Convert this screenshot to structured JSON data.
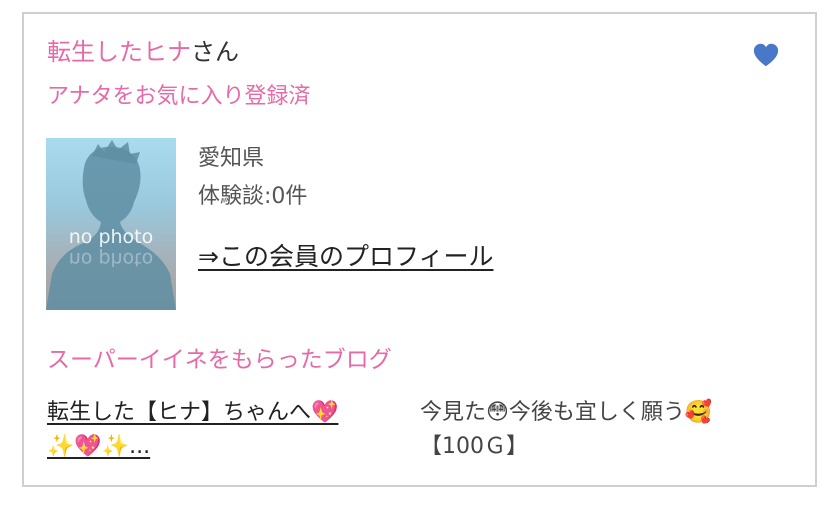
{
  "member": {
    "name": "転生したヒナ",
    "honorific": "さん",
    "favorite_status": "アナタをお気に入り登録済",
    "photo_placeholder": "no photo",
    "prefecture": "愛知県",
    "reviews": "体験談:0件",
    "profile_link": "⇒この会員のプロフィール",
    "heart_icon": "heart-icon",
    "colors": {
      "pink": "#e66aa8",
      "heart": "#4a78c8"
    }
  },
  "blog": {
    "section_title": "スーパーイイネをもらったブログ",
    "title_line1": "転生した【ヒナ】ちゃんへ💖",
    "title_line2": "✨💖✨...",
    "body_line1": "今見た😳今後も宜しく願う🥰",
    "body_line2": "【100Ｇ】"
  }
}
